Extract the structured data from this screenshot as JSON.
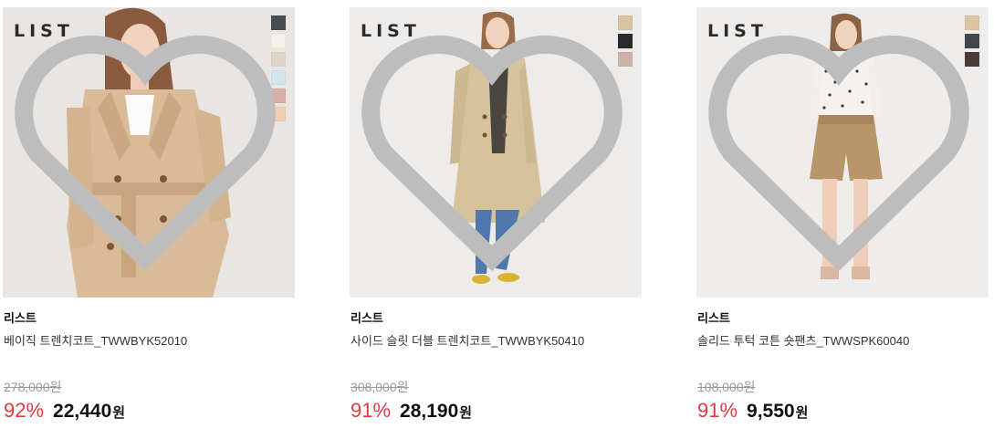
{
  "products": [
    {
      "logo": "LIST",
      "brand": "리스트",
      "name": "베이직 트렌치코트_TWWBYK52010",
      "original_price": "278,000원",
      "discount": "92%",
      "sale_price": "22,440",
      "currency": "원",
      "swatches": [
        "#474d52",
        "#f5f0e8",
        "#ddd6c8",
        "#cfe6ea",
        "#dcaea8",
        "#efcfae"
      ],
      "wishlist_icon": "heart-outline-icon"
    },
    {
      "logo": "LIST",
      "brand": "리스트",
      "name": "사이드 슬릿 더블 트렌치코트_TWWBYK50410",
      "original_price": "308,000원",
      "discount": "91%",
      "sale_price": "28,190",
      "currency": "원",
      "swatches": [
        "#d9c4a2",
        "#2a2a2d",
        "#cdb3aa"
      ],
      "wishlist_icon": "heart-outline-icon"
    },
    {
      "logo": "LIST",
      "brand": "리스트",
      "name": "솔리드 투턱 코튼 숏팬츠_TWWSPK60040",
      "original_price": "108,000원",
      "discount": "91%",
      "sale_price": "9,550",
      "currency": "원",
      "swatches": [
        "#dcc49e",
        "#41474b",
        "#4d3b37"
      ],
      "wishlist_icon": "heart-outline-icon"
    }
  ]
}
